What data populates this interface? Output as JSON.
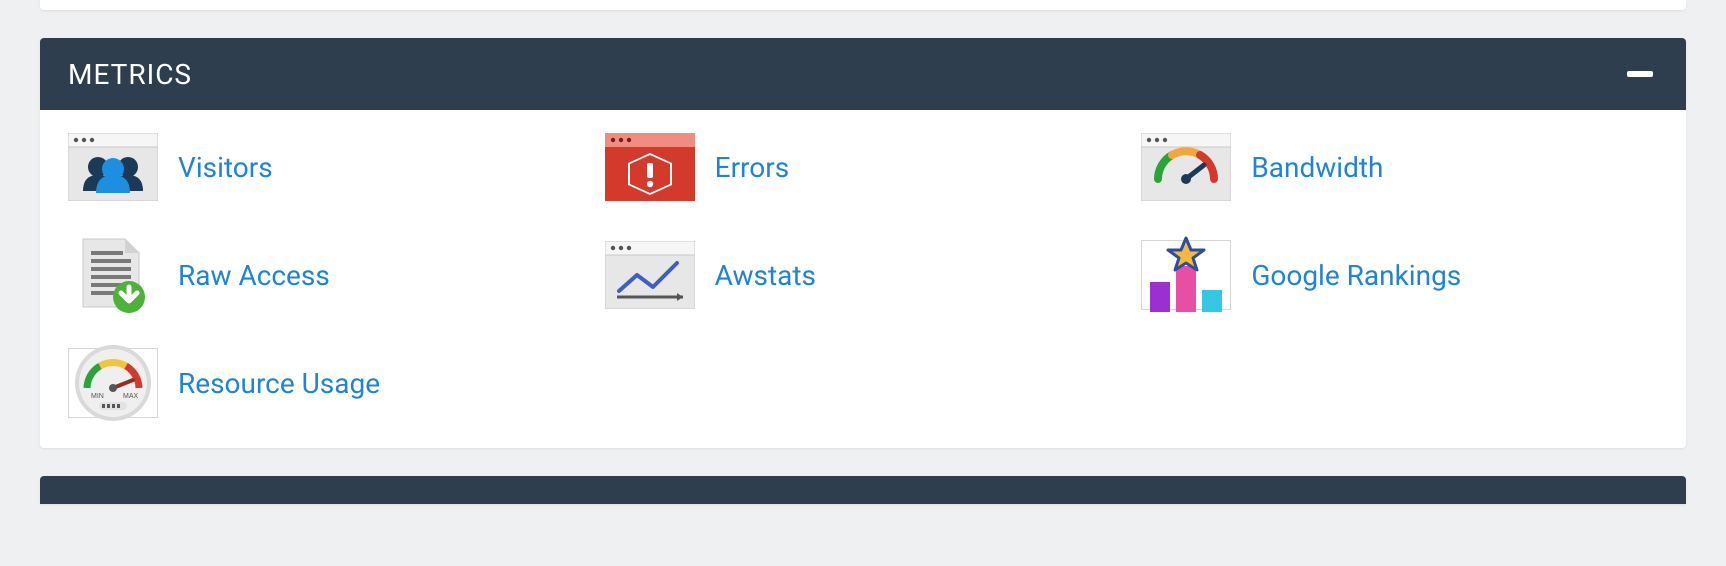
{
  "panel": {
    "title": "METRICS",
    "items": [
      {
        "label": "Visitors",
        "icon": "visitors-icon"
      },
      {
        "label": "Errors",
        "icon": "errors-icon"
      },
      {
        "label": "Bandwidth",
        "icon": "bandwidth-icon"
      },
      {
        "label": "Raw Access",
        "icon": "raw-access-icon"
      },
      {
        "label": "Awstats",
        "icon": "awstats-icon"
      },
      {
        "label": "Google Rankings",
        "icon": "google-rankings-icon"
      },
      {
        "label": "Resource Usage",
        "icon": "resource-usage-icon"
      }
    ]
  }
}
